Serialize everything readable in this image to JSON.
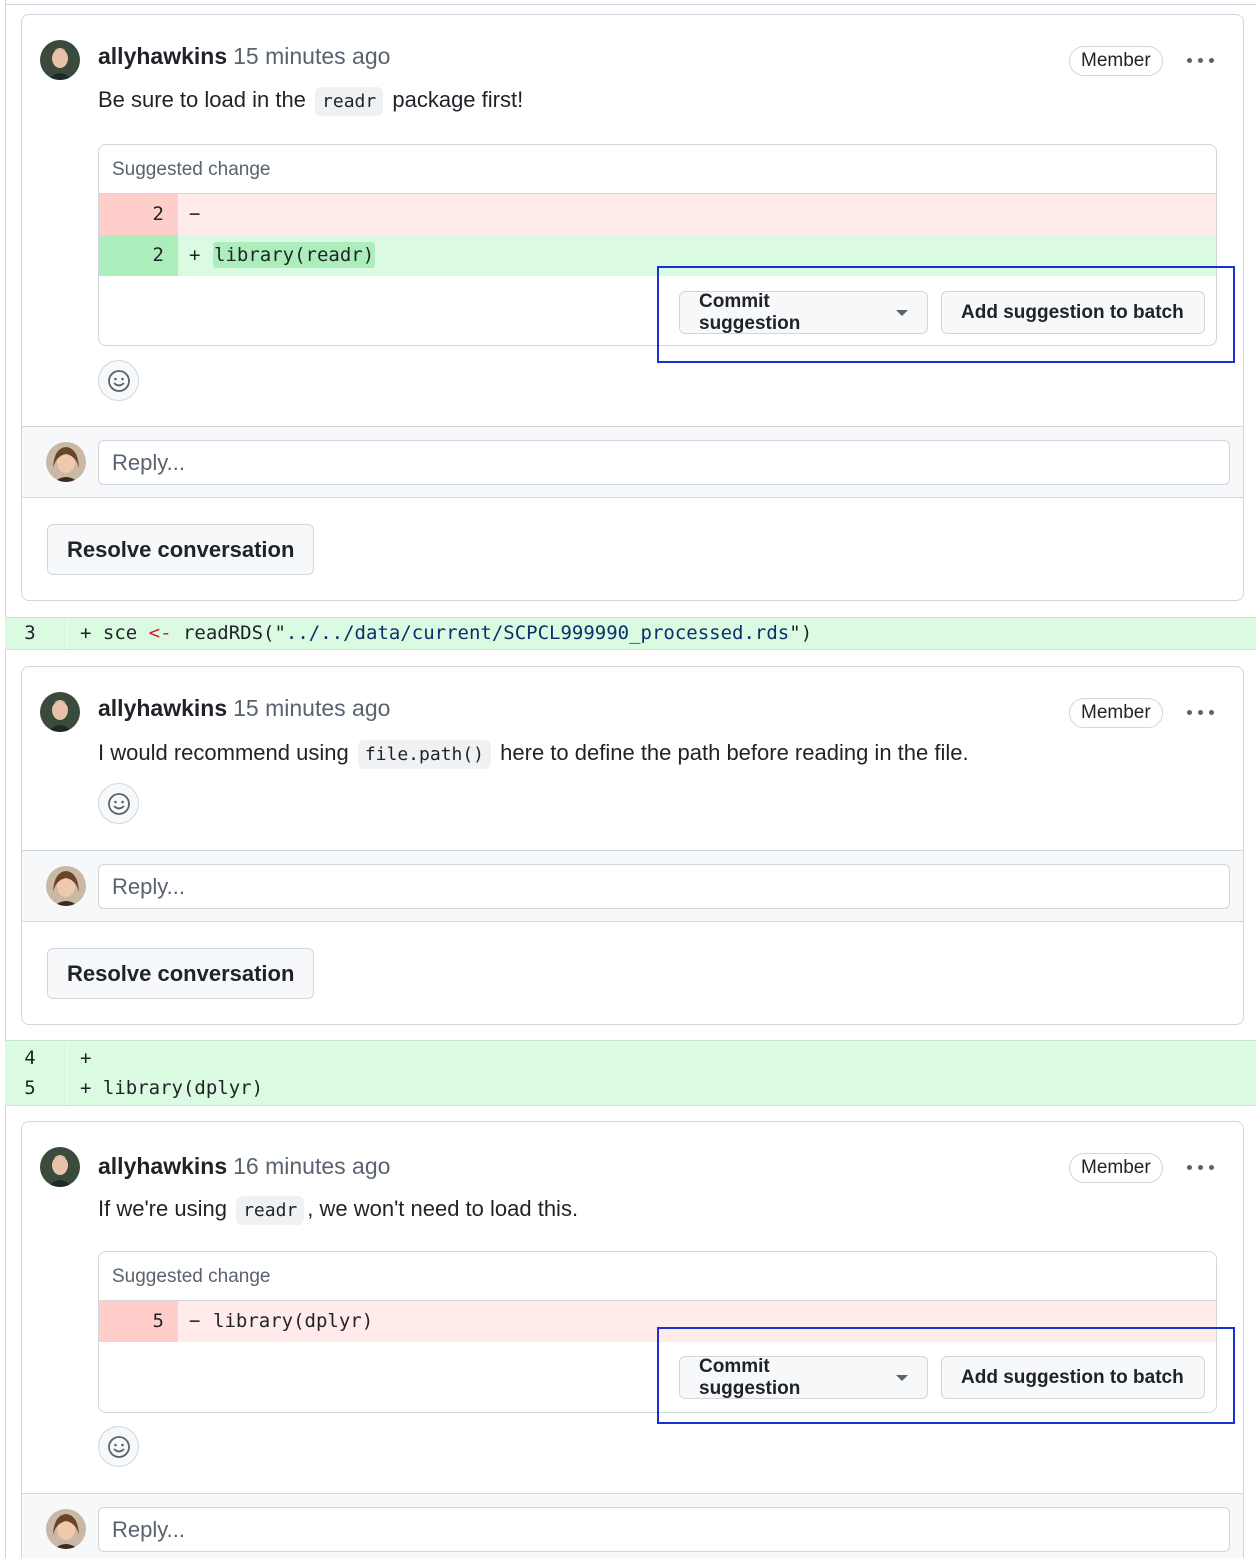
{
  "threads": [
    {
      "author": "allyhawkins",
      "timestamp": "15 minutes ago",
      "badge": "Member",
      "body": {
        "before": "Be sure to load in the",
        "code": "readr",
        "after": "package first!"
      },
      "suggestion": {
        "header": "Suggested change",
        "lines": [
          {
            "num": "2",
            "sign": "−",
            "code": ""
          },
          {
            "num": "2",
            "sign": "+",
            "code": "library(readr)"
          }
        ]
      },
      "commit_label": "Commit suggestion",
      "batch_label": "Add suggestion to batch",
      "reply_placeholder": "Reply...",
      "resolve_label": "Resolve conversation"
    },
    {
      "author": "allyhawkins",
      "timestamp": "15 minutes ago",
      "badge": "Member",
      "body": {
        "before": "I would recommend using",
        "code": "file.path()",
        "after": "here to define the path before reading in the file."
      },
      "reply_placeholder": "Reply...",
      "resolve_label": "Resolve conversation"
    },
    {
      "author": "allyhawkins",
      "timestamp": "16 minutes ago",
      "badge": "Member",
      "body": {
        "before": "If we're using",
        "code": "readr",
        "after": ", we won't need to load this."
      },
      "suggestion": {
        "header": "Suggested change",
        "lines": [
          {
            "num": "5",
            "sign": "−",
            "code": "library(dplyr)"
          }
        ]
      },
      "commit_label": "Commit suggestion",
      "batch_label": "Add suggestion to batch",
      "reply_placeholder": "Reply..."
    }
  ],
  "code_lines": [
    {
      "num": "3",
      "prefix": "+ sce ",
      "op": "<-",
      "mid": " readRDS(\"",
      "str": "../../data/current/SCPCL999990_processed.rds",
      "end": "\")"
    },
    {
      "num": "4",
      "text": "+"
    },
    {
      "num": "5",
      "text": "+ library(dplyr)"
    }
  ],
  "colors": {
    "addition_bg": "#dafbe1",
    "deletion_bg": "#ffebe9",
    "highlight_box": "#1a2fd4",
    "border": "#d0d7de"
  }
}
